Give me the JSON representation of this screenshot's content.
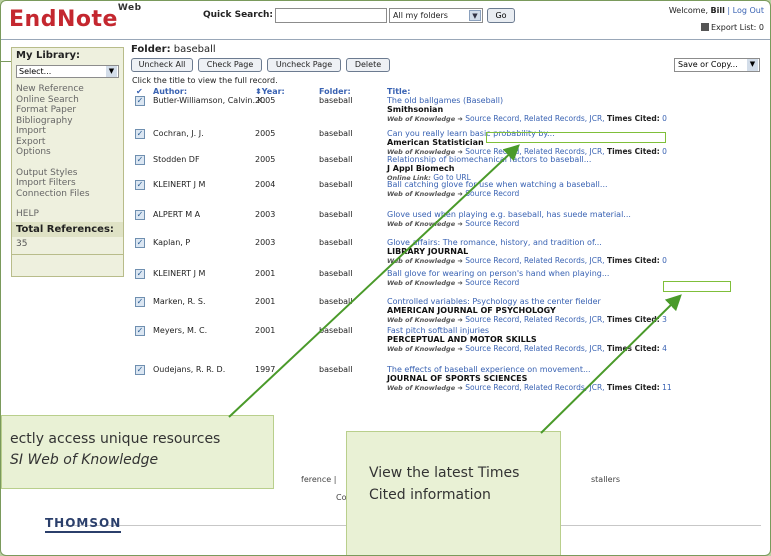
{
  "header": {
    "logo": "EndNote",
    "logo_sup": "Web",
    "quick_search_label": "Quick Search:",
    "quick_search_value": "",
    "folder_select": "All my folders",
    "go_label": "Go",
    "welcome_prefix": "Welcome,",
    "user": "Bill",
    "separator": "|",
    "logout": "Log Out",
    "export_list": "Export List: 0"
  },
  "sidebar": {
    "title": "My Library:",
    "select": "Select...",
    "links_group1": [
      "New Reference",
      "Online Search",
      "Format Paper",
      "Bibliography",
      "Import",
      "Export",
      "Options"
    ],
    "links_group2": [
      "Output Styles",
      "Import Filters",
      "Connection Files"
    ],
    "help": "HELP",
    "total_label": "Total References:",
    "total_count": "35"
  },
  "main": {
    "folder_prefix": "Folder:",
    "folder_name": "baseball",
    "buttons": {
      "uncheck_all": "Uncheck All",
      "check_page": "Check Page",
      "uncheck_page": "Uncheck Page",
      "delete": "Delete",
      "save_or_copy": "Save or Copy..."
    },
    "hint": "Click the title to view the full record.",
    "columns": {
      "check": "✔",
      "author": "Author:",
      "year": "Year:",
      "folder": "Folder:",
      "title": "Title:"
    }
  },
  "records": [
    {
      "author": "Butler-Williamson, Calvin. K.",
      "year": "2005",
      "folder": "baseball",
      "title": "The old ballgames (Baseball)",
      "journal": "Smithsonian",
      "wok_label": "Web of Knowledge ➜",
      "links": "Source Record, Related Records, JCR,",
      "times_cited_label": "Times Cited:",
      "times_cited": "0"
    },
    {
      "author": "Cochran, J. J.",
      "year": "2005",
      "folder": "baseball",
      "title": "Can you really learn basic probability by...",
      "journal": "American Statistician",
      "wok_label": "Web of Knowledge ➜",
      "links": "Source Record, Related Records, JCR,",
      "times_cited_label": "Times Cited:",
      "times_cited": "0"
    },
    {
      "author": "Stodden DF",
      "year": "2005",
      "folder": "baseball",
      "title": "Relationship of biomechanical factors to baseball...",
      "journal": "J Appl Biomech",
      "wok_label": "Online Link:",
      "links": "Go to URL",
      "times_cited_label": "",
      "times_cited": ""
    },
    {
      "author": "KLEINERT J M",
      "year": "2004",
      "folder": "baseball",
      "title": "Ball catching glove for use when watching a baseball...",
      "journal": "",
      "wok_label": "Web of Knowledge ➜",
      "links": "Source Record",
      "times_cited_label": "",
      "times_cited": ""
    },
    {
      "author": "ALPERT M A",
      "year": "2003",
      "folder": "baseball",
      "title": "Glove used when playing e.g. baseball, has suede material...",
      "journal": "",
      "wok_label": "Web of Knowledge ➜",
      "links": "Source Record",
      "times_cited_label": "",
      "times_cited": ""
    },
    {
      "author": "Kaplan, P",
      "year": "2003",
      "folder": "baseball",
      "title": "Glove affairs: The romance, history, and tradition of...",
      "journal": "LIBRARY JOURNAL",
      "wok_label": "Web of Knowledge ➜",
      "links": "Source Record, Related Records, JCR,",
      "times_cited_label": "Times Cited:",
      "times_cited": "0"
    },
    {
      "author": "KLEINERT J M",
      "year": "2001",
      "folder": "baseball",
      "title": "Ball glove for wearing on person's hand when playing...",
      "journal": "",
      "wok_label": "Web of Knowledge ➜",
      "links": "Source Record",
      "times_cited_label": "",
      "times_cited": ""
    },
    {
      "author": "Marken, R. S.",
      "year": "2001",
      "folder": "baseball",
      "title": "Controlled variables: Psychology as the center fielder",
      "journal": "AMERICAN JOURNAL OF PSYCHOLOGY",
      "wok_label": "Web of Knowledge ➜",
      "links": "Source Record, Related Records, JCR,",
      "times_cited_label": "Times Cited:",
      "times_cited": "3"
    },
    {
      "author": "Meyers, M. C.",
      "year": "2001",
      "folder": "baseball",
      "title": "Fast pitch softball injuries",
      "journal": "PERCEPTUAL AND MOTOR SKILLS",
      "wok_label": "Web of Knowledge ➜",
      "links": "Source Record, Related Records, JCR,",
      "times_cited_label": "Times Cited:",
      "times_cited": "4"
    },
    {
      "author": "Oudejans, R. R. D.",
      "year": "1997",
      "folder": "baseball",
      "title": "The effects of baseball experience on movement...",
      "journal": "JOURNAL OF SPORTS SCIENCES",
      "wok_label": "Web of Knowledge ➜",
      "links": "Source Record, Related Records, JCR,",
      "times_cited_label": "Times Cited:",
      "times_cited": "11"
    }
  ],
  "footer": {
    "frag1": "ference |",
    "frag2": "stallers",
    "frag3": "Co",
    "brand": "THOMSON"
  },
  "callouts": {
    "left_line1": "ectly access unique resources",
    "left_line2": "SI Web of Knowledge",
    "right_text": "View the latest Times Cited information"
  },
  "colors": {
    "logo_red": "#c4272f",
    "link_blue": "#3a63b3",
    "callout_bg": "#e9f1d5",
    "arrow_green": "#4a9a2a"
  }
}
